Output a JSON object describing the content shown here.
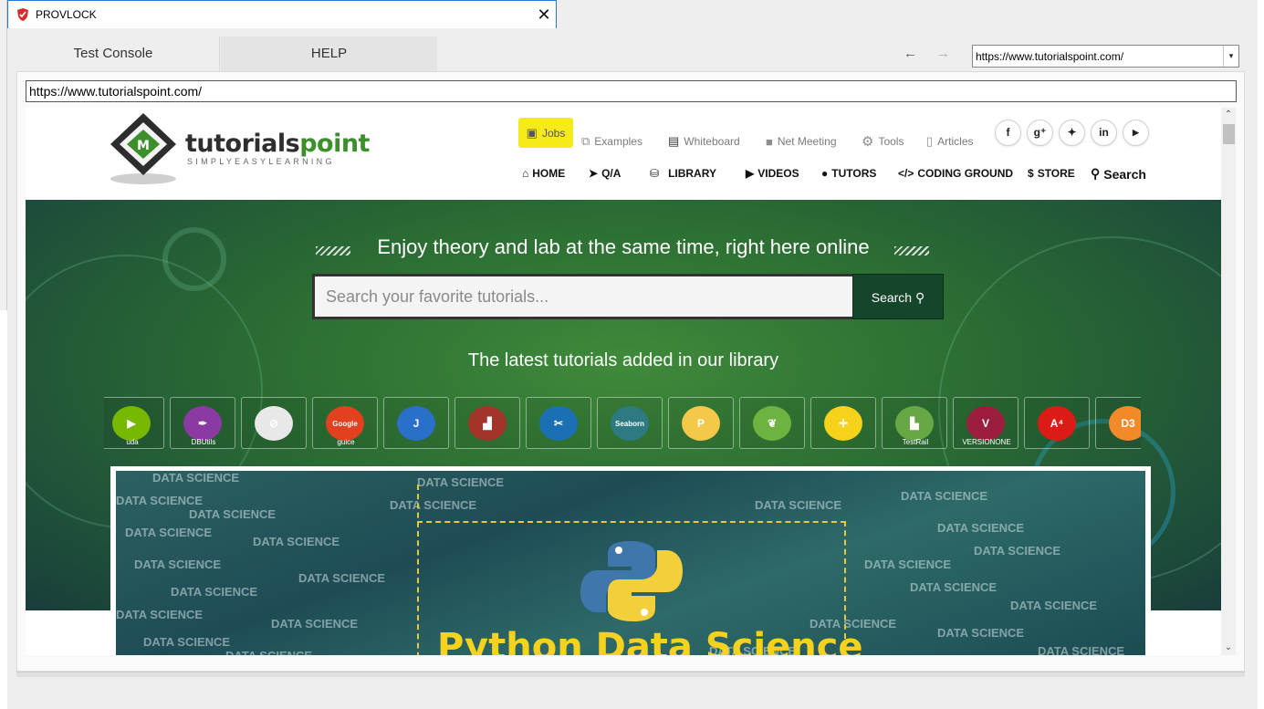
{
  "window": {
    "title": "PROVLOCK",
    "close_glyph": "✕"
  },
  "tabs": [
    {
      "label": "Test Console"
    },
    {
      "label": "HELP"
    }
  ],
  "nav": {
    "back_glyph": "←",
    "forward_glyph": "→"
  },
  "url_combo": {
    "value": "https://www.tutorialspoint.com/",
    "dropdown_glyph": "▾"
  },
  "address_bar": {
    "value": "https://www.tutorialspoint.com/"
  },
  "scrollbar": {
    "up_glyph": "⌃",
    "down_glyph": "⌄"
  },
  "site": {
    "logo": {
      "brand_prefix": "tutorials",
      "brand_suffix": "point",
      "tagline": "SIMPLYEASYLEARNING"
    },
    "top_links": [
      {
        "label": "Jobs",
        "icon": "briefcase-icon",
        "glyph": "▣"
      },
      {
        "label": "Examples",
        "icon": "cubes-icon",
        "glyph": "⧉"
      },
      {
        "label": "Whiteboard",
        "icon": "whiteboard-icon",
        "glyph": "▤"
      },
      {
        "label": "Net Meeting",
        "icon": "video-camera-icon",
        "glyph": "■"
      },
      {
        "label": "Tools",
        "icon": "gear-icon",
        "glyph": "⚙"
      },
      {
        "label": "Articles",
        "icon": "document-icon",
        "glyph": "▯"
      }
    ],
    "social": [
      {
        "name": "facebook-icon",
        "glyph": "f"
      },
      {
        "name": "google-plus-icon",
        "glyph": "g⁺"
      },
      {
        "name": "twitter-icon",
        "glyph": "✦"
      },
      {
        "name": "linkedin-icon",
        "glyph": "in"
      },
      {
        "name": "youtube-icon",
        "glyph": "▶"
      }
    ],
    "main_nav": [
      {
        "label": "HOME",
        "glyph": "⌂"
      },
      {
        "label": "Q/A",
        "glyph": "➤"
      },
      {
        "label": "LIBRARY",
        "glyph": "⛁"
      },
      {
        "label": "VIDEOS",
        "glyph": "▶"
      },
      {
        "label": "TUTORS",
        "glyph": "●"
      },
      {
        "label": "CODING GROUND",
        "glyph": "</>"
      },
      {
        "label": "STORE",
        "glyph": "$"
      },
      {
        "label": "Search",
        "glyph": "⚲"
      }
    ],
    "banner": {
      "title": "Enjoy theory and lab at the same time, right here online",
      "search_placeholder": "Search your favorite tutorials...",
      "search_button": "Search",
      "search_glyph": "⚲",
      "latest_title": "The latest tutorials added in our library"
    },
    "library_icons": [
      {
        "name": "nvidia-cuda-icon",
        "caption": "uda",
        "color": "#76b900",
        "glyph": "▶"
      },
      {
        "name": "dbutils-icon",
        "caption": "DBUtils",
        "color": "#8a3aa0",
        "glyph": "✒"
      },
      {
        "name": "no-bugs-icon",
        "caption": "",
        "color": "#e8e8e8",
        "glyph": "⊘"
      },
      {
        "name": "google-guice-icon",
        "caption": "guice",
        "color": "#e2401f",
        "glyph": "Google"
      },
      {
        "name": "jbehave-icon",
        "caption": "",
        "color": "#2a6fc9",
        "glyph": "J"
      },
      {
        "name": "bag-icon",
        "caption": "",
        "color": "#a4342a",
        "glyph": "▟"
      },
      {
        "name": "tools-icon",
        "caption": "",
        "color": "#1a6fb5",
        "glyph": "✂"
      },
      {
        "name": "seaborn-icon",
        "caption": "",
        "color": "#2d7a82",
        "glyph": "Seaborn"
      },
      {
        "name": "pycharm-icon",
        "caption": "",
        "color": "#f4c94a",
        "glyph": "P"
      },
      {
        "name": "spring-icon",
        "caption": "",
        "color": "#6db33f",
        "glyph": "❦"
      },
      {
        "name": "crosshair-icon",
        "caption": "",
        "color": "#f6d21b",
        "glyph": "✛"
      },
      {
        "name": "testrail-icon",
        "caption": "TestRail",
        "color": "#67a845",
        "glyph": "▙"
      },
      {
        "name": "versionone-icon",
        "caption": "VERSIONONE",
        "color": "#9b1e3e",
        "glyph": "V"
      },
      {
        "name": "angular-icon",
        "caption": "",
        "color": "#dd1b16",
        "glyph": "A⁴"
      },
      {
        "name": "d3-icon",
        "caption": "",
        "color": "#f28a2a",
        "glyph": "D3"
      }
    ],
    "featured": {
      "watermark": "DATA SCIENCE",
      "title": "Python Data Science"
    }
  },
  "colors": {
    "jobs_highlight": "#f7ea1b",
    "brand_green": "#3d8f2c",
    "search_button": "#15452a",
    "featured_title": "#f5d21e"
  }
}
